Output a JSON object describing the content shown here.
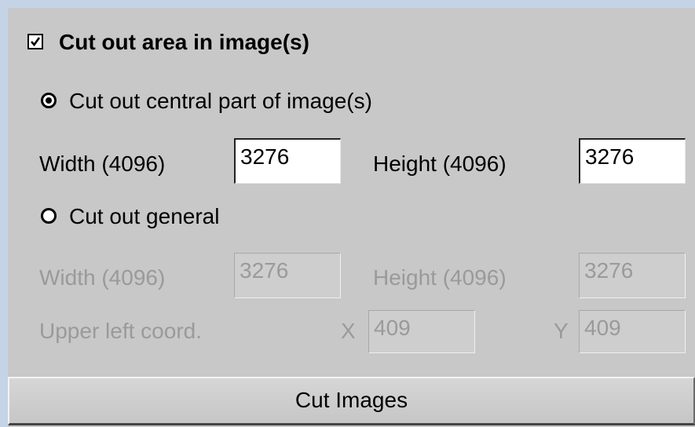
{
  "cutout": {
    "enable_label": "Cut out area in image(s)",
    "enable_checked": true,
    "central": {
      "label": "Cut out central part of image(s)",
      "selected": true,
      "width_label": "Width (4096)",
      "width_value": "3276",
      "height_label": "Height (4096)",
      "height_value": "3276"
    },
    "general": {
      "label": "Cut out general",
      "selected": false,
      "width_label": "Width (4096)",
      "width_value": "3276",
      "height_label": "Height (4096)",
      "height_value": "3276",
      "coord_label": "Upper left coord.",
      "x_label": "X",
      "x_value": "409",
      "y_label": "Y",
      "y_value": "409"
    },
    "button_label": "Cut Images"
  }
}
